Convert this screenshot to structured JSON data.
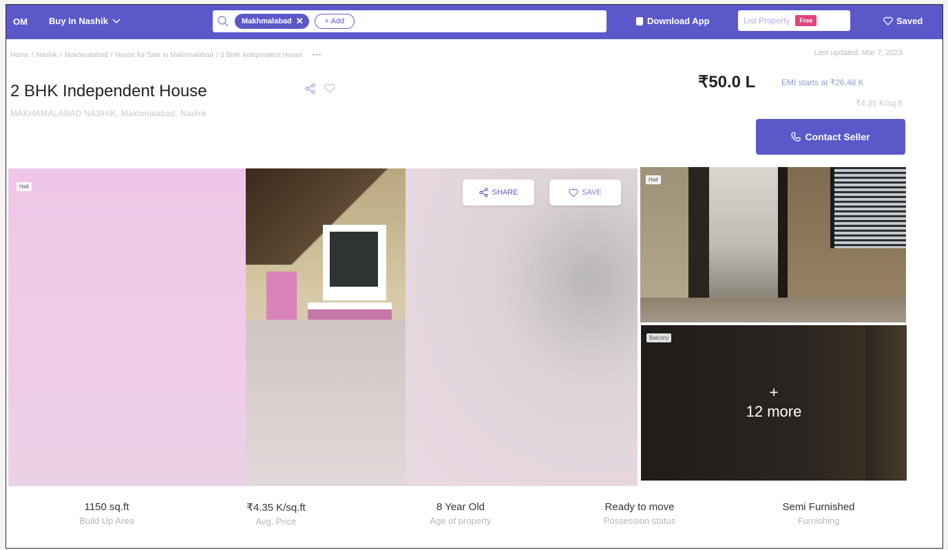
{
  "nav": {
    "brand": "OM",
    "city_menu": "Buy In Nashik",
    "search_chip": "Makhmalabad",
    "add_chip": "+ Add",
    "download_app": "Download App",
    "list_property": "List Property",
    "free_badge": "Free",
    "saved": "Saved",
    "accent_color": "#5b59c9"
  },
  "breadcrumb": {
    "items": [
      "Home",
      "Nashik",
      "Makhmalabad",
      "House for Sale in Makhmalabad",
      "2 BHK Independent House"
    ],
    "separator": "/",
    "more": "•••"
  },
  "last_updated": "Last updated: Mar 7, 2023",
  "property": {
    "title": "2 BHK Independent House",
    "address": "MAKHAMALABAD NASHIK, Makhmalabad, Nashik",
    "price": "₹50.0 L",
    "emi": "EMI starts at ₹26.48 K",
    "price_per_sqft": "₹4.35 K/sq.ft",
    "contact_button": "Contact Seller"
  },
  "gallery": {
    "main_tag": "Hall",
    "share_label": "SHARE",
    "save_label": "SAVE",
    "hall_tag": "Hall",
    "balcony_tag": "Balcony",
    "more_plus": "+",
    "more_label": "12 more"
  },
  "stats": [
    {
      "value": "1150 sq.ft",
      "label": "Build Up Area"
    },
    {
      "value": "₹4.35 K/sq.ft",
      "label": "Avg. Price"
    },
    {
      "value": "8 Year Old",
      "label": "Age of property"
    },
    {
      "value": "Ready to move",
      "label": "Possession status"
    },
    {
      "value": "Semi Furnished",
      "label": "Furnishing"
    }
  ],
  "icons": [
    "search-icon",
    "close-icon",
    "chevron-down-icon",
    "phone-icon",
    "share-icon",
    "heart-icon",
    "download-icon"
  ]
}
